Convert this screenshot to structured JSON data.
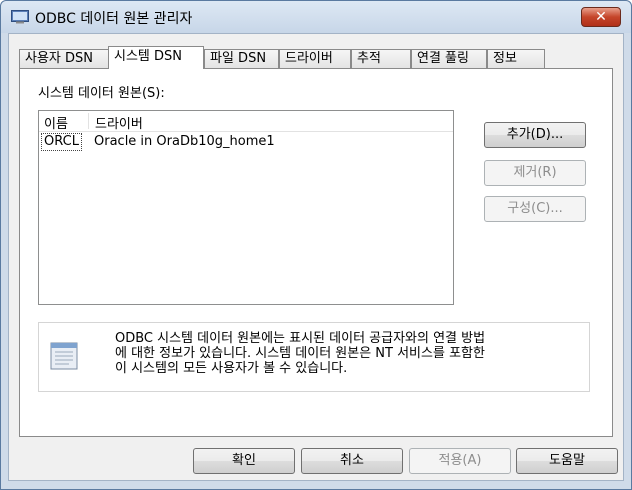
{
  "window": {
    "title": "ODBC 데이터 원본 관리자",
    "close_glyph": "✕"
  },
  "tabs": [
    {
      "label": "사용자 DSN"
    },
    {
      "label": "시스템 DSN"
    },
    {
      "label": "파일 DSN"
    },
    {
      "label": "드라이버"
    },
    {
      "label": "추적"
    },
    {
      "label": "연결 풀링"
    },
    {
      "label": "정보"
    }
  ],
  "active_tab": "시스템 DSN",
  "panel": {
    "list_label": "시스템 데이터 원본(S):",
    "columns": [
      "이름",
      "드라이버"
    ],
    "rows": [
      {
        "name": "ORCL",
        "driver": "Oracle in OraDb10g_home1"
      }
    ],
    "buttons": {
      "add": "추가(D)...",
      "remove": "제거(R)",
      "configure": "구성(C)..."
    },
    "info_lines": [
      "ODBC 시스템 데이터 원본에는 표시된 데이터 공급자와의 연결 방법",
      "에 대한 정보가 있습니다. 시스템 데이터 원본은 NT 서비스를 포함한",
      "이 시스템의 모든 사용자가 볼 수 있습니다."
    ]
  },
  "footer": {
    "ok": "확인",
    "cancel": "취소",
    "apply": "적용(A)",
    "help": "도움말"
  },
  "colors": {
    "titlebar": "#c7d6e8",
    "close": "#c5452a",
    "face": "#f0f0f0",
    "disabled_text": "#8d8d8d"
  },
  "icons": {
    "app": "odbc-app-icon",
    "info": "database-document-icon",
    "close": "close-icon"
  }
}
